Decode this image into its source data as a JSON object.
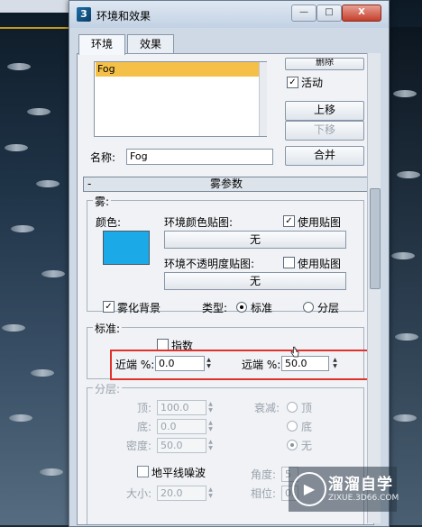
{
  "window": {
    "title": "环境和效果",
    "controls": {
      "min": "—",
      "max": "□",
      "close": "X"
    }
  },
  "tabs": [
    "环境",
    "效果"
  ],
  "effects": {
    "items": [
      "Fog"
    ],
    "delete_label": "删除",
    "active_label": "活动",
    "move_up_label": "上移",
    "move_down_label": "下移",
    "name_label": "名称:",
    "name_value": "Fog",
    "merge_label": "合并"
  },
  "rollout": {
    "title": "雾参数",
    "collapse": "-"
  },
  "fog": {
    "group_label": "雾:",
    "color_label": "颜色:",
    "color_hex": "#1ba9e8",
    "env_map_label": "环境颜色贴图:",
    "use_map_label": "使用贴图",
    "env_map_value": "无",
    "opacity_map_label": "环境不透明度贴图:",
    "opacity_use_map_label": "使用贴图",
    "opacity_map_value": "无",
    "fog_bg_label": "雾化背景",
    "type_label": "类型:",
    "type_standard": "标准",
    "type_layered": "分层"
  },
  "standard": {
    "group_label": "标准:",
    "exponential_label": "指数",
    "near_label": "近端 %:",
    "near_value": "0.0",
    "far_label": "远端 %:",
    "far_value": "50.0"
  },
  "layered": {
    "group_label": "分层:",
    "top_label": "顶:",
    "top_value": "100.0",
    "bottom_label": "底:",
    "bottom_value": "0.0",
    "density_label": "密度:",
    "density_value": "50.0",
    "falloff_label": "衰减:",
    "falloff_top": "顶",
    "falloff_bottom": "底",
    "falloff_none": "无",
    "horizon_noise_label": "地平线噪波",
    "size_label": "大小:",
    "size_value": "20.0",
    "angle_label": "角度:",
    "angle_value": "5",
    "phase_label": "相位:",
    "phase_value": "0."
  },
  "watermark": {
    "name": "溜溜自学",
    "url": "ZIXUE.3D66.COM"
  },
  "colors": {
    "highlight": "#e0322a",
    "selected_item": "#f5c048"
  }
}
